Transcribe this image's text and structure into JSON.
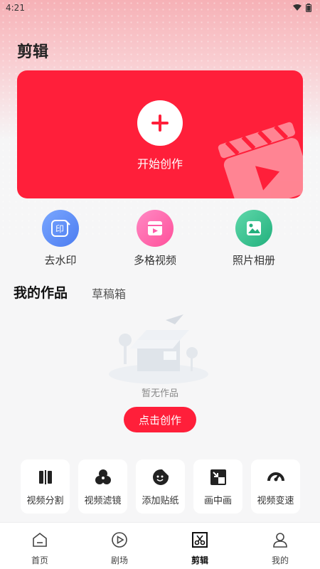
{
  "status": {
    "time": "4:21"
  },
  "page": {
    "title": "剪辑"
  },
  "hero": {
    "label": "开始创作"
  },
  "quick_actions": [
    {
      "label": "去水印",
      "badge": "印",
      "color": "#5b8ff5"
    },
    {
      "label": "多格视频",
      "color": "#ff5aa8"
    },
    {
      "label": "照片相册",
      "color": "#33c28f"
    }
  ],
  "tabs": {
    "works": "我的作品",
    "drafts": "草稿箱"
  },
  "empty": {
    "text": "暂无作品",
    "button": "点击创作"
  },
  "tools": [
    {
      "label": "视频分割",
      "icon": "split-icon"
    },
    {
      "label": "视频滤镜",
      "icon": "filter-icon"
    },
    {
      "label": "添加贴纸",
      "icon": "sticker-icon"
    },
    {
      "label": "画中画",
      "icon": "pip-icon"
    },
    {
      "label": "视频变速",
      "icon": "speed-icon"
    }
  ],
  "nav": [
    {
      "label": "首页",
      "icon": "home-icon"
    },
    {
      "label": "剧场",
      "icon": "play-icon"
    },
    {
      "label": "剪辑",
      "icon": "edit-icon",
      "active": true
    },
    {
      "label": "我的",
      "icon": "user-icon"
    }
  ],
  "colors": {
    "accent": "#ff1f3a"
  }
}
